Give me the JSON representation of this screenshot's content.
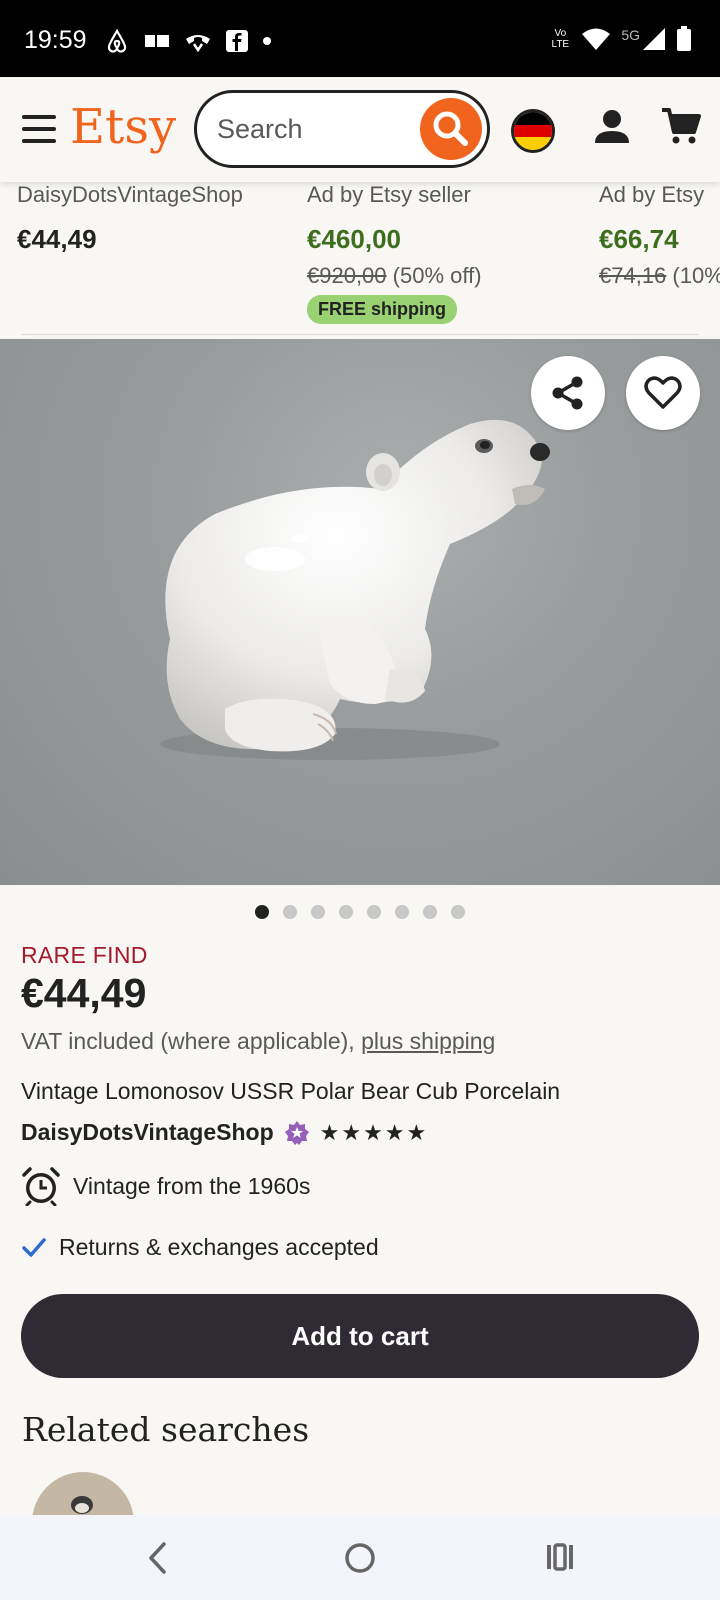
{
  "status_bar": {
    "time": "19:59",
    "network_label": "5G",
    "volte_label": "Vo LTE"
  },
  "header": {
    "logo": "Etsy",
    "search_placeholder": "Search"
  },
  "cards": [
    {
      "shop": "DaisyDotsVintageShop",
      "price": "€44,49"
    },
    {
      "shop": "Ad by Etsy seller",
      "price": "€460,00",
      "original_price": "€920,00",
      "discount": "(50% off)",
      "badge": "FREE shipping"
    },
    {
      "shop": "Ad by Etsy",
      "price": "€66,74",
      "original_price": "€74,16",
      "discount": "(10%"
    }
  ],
  "product": {
    "rare_find": "RARE FIND",
    "price": "€44,49",
    "vat_text": "VAT included (where applicable),",
    "shipping_link": "plus shipping",
    "title": "Vintage Lomonosov USSR Polar Bear Cub Porcelain",
    "shop_name": "DaisyDotsVintageShop",
    "stars": "★★★★★",
    "star_rating": 5,
    "feature_vintage": "Vintage from the 1960s",
    "feature_returns": "Returns & exchanges accepted",
    "add_to_cart": "Add to cart",
    "image_count": 8,
    "active_image": 1
  },
  "related_searches": {
    "heading": "Related searches"
  },
  "colors": {
    "brand": "#f1641e",
    "rare_find": "#a61a2e",
    "sale_price": "#3d6e1e",
    "free_shipping_bg": "#9ad172",
    "cart_button": "#2f2a33"
  }
}
